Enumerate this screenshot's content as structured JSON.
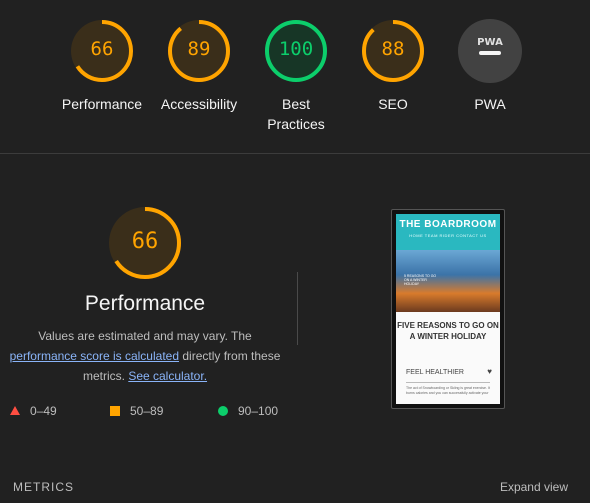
{
  "categories": [
    {
      "label": "Performance",
      "score": "66",
      "value": 66,
      "color": "#ffa400",
      "bg": "#3a2e1a"
    },
    {
      "label": "Accessibility",
      "score": "89",
      "value": 89,
      "color": "#ffa400",
      "bg": "#3a2e1a"
    },
    {
      "label": "Best Practices",
      "score": "100",
      "value": 100,
      "color": "#0cce6b",
      "bg": "#173626"
    },
    {
      "label": "SEO",
      "score": "88",
      "value": 88,
      "color": "#ffa400",
      "bg": "#3a2e1a"
    },
    {
      "label": "PWA",
      "score": "",
      "value": 0,
      "color": "#424242",
      "bg": "#424242",
      "icon": "pwa-badge-icon",
      "badge_text": "PWA"
    }
  ],
  "detail": {
    "score": "66",
    "value": 66,
    "title": "Performance",
    "desc_prefix": "Values are estimated and may vary. The",
    "link_text": "performance score is calculated",
    "desc_middle": "directly from these metrics.",
    "calc_link": "See calculator.",
    "accent": "#ffa400"
  },
  "legend": [
    {
      "range": "0–49",
      "shape": "triangle",
      "color": "#ff4e42"
    },
    {
      "range": "50–89",
      "shape": "square",
      "color": "#ffa400"
    },
    {
      "range": "90–100",
      "shape": "circle",
      "color": "#0cce6b"
    }
  ],
  "thumbnail": {
    "site_title": "THE BOARDROOM",
    "nav": "HOME   TEAM RIDER   CONTACT US",
    "caption": "5 REASONS TO GO ON A WINTER HOLIDAY",
    "headline": "FIVE REASONS TO GO ON A WINTER HOLIDAY",
    "section": "FEEL HEALTHIER",
    "paragraph": "The act of Snowboarding or Skiing is great exercise. It burns calories and you can successfully activate your"
  },
  "footer": {
    "metrics_label": "METRICS",
    "expand_label": "Expand view"
  }
}
